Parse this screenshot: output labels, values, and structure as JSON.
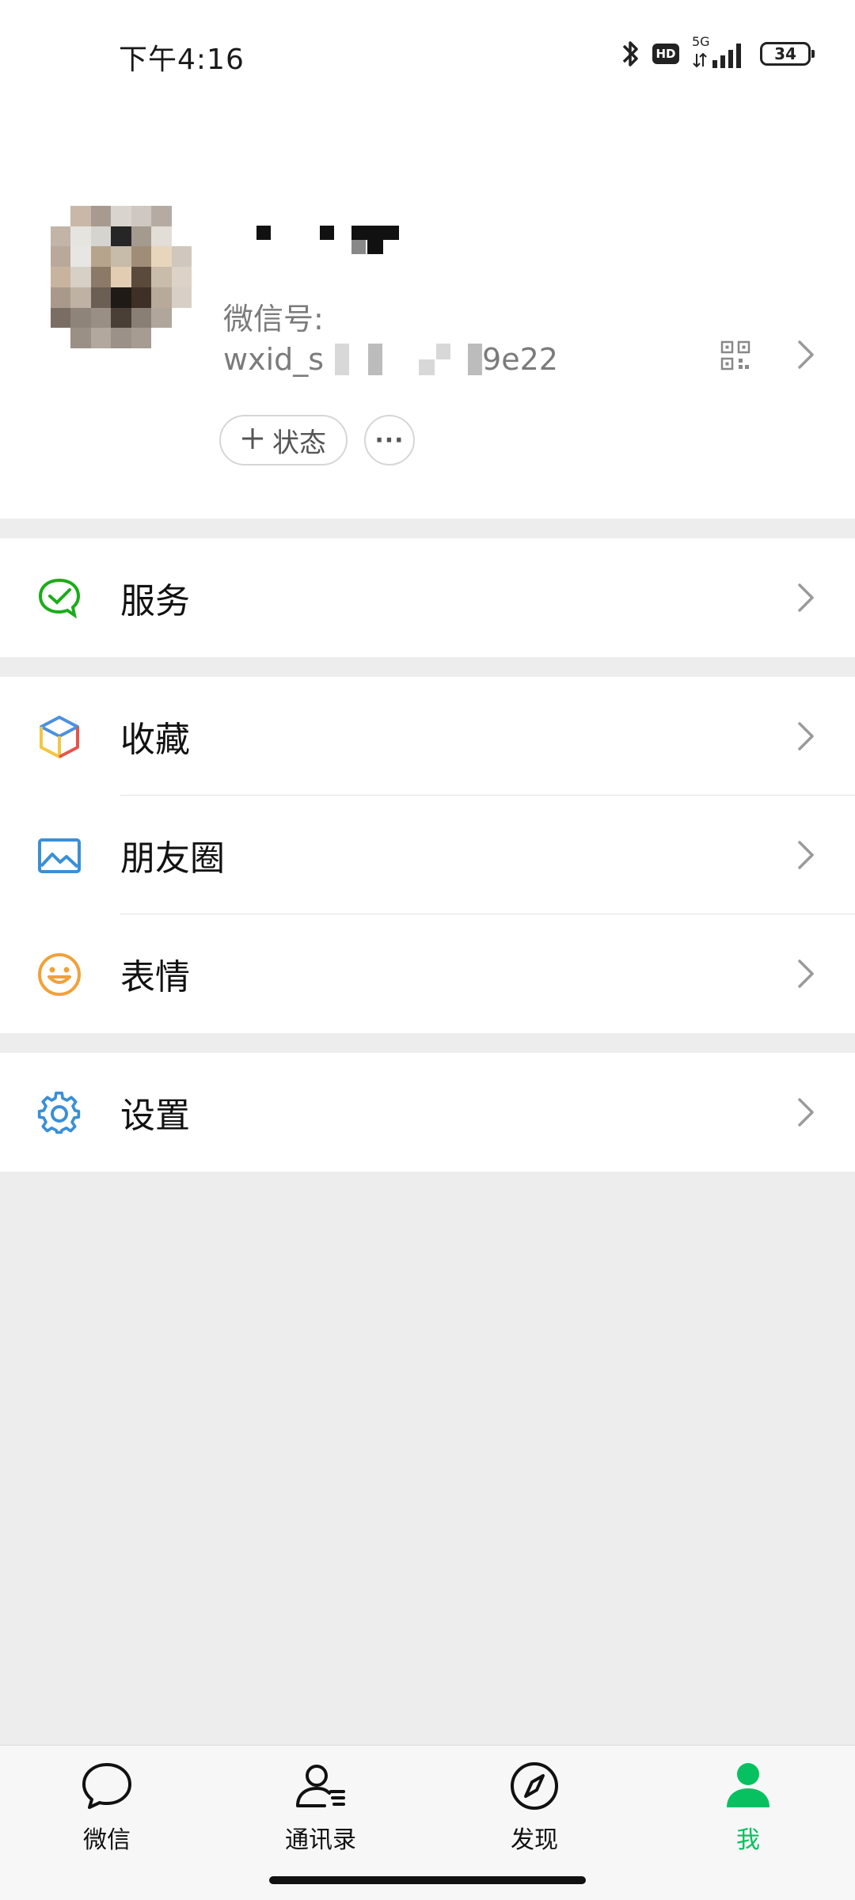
{
  "status_bar": {
    "time": "下午4:16",
    "hd_badge": "HD",
    "network": "5G",
    "battery": "34"
  },
  "profile": {
    "wechat_id_label": "微信号:",
    "wechat_id_prefix": "wxid_s",
    "wechat_id_suffix": "9e22",
    "status_chip_label": "状态",
    "more_chip_label": "···"
  },
  "menu": {
    "services": "服务",
    "favorites": "收藏",
    "moments": "朋友圈",
    "stickers": "表情",
    "settings": "设置"
  },
  "tabbar": {
    "chats": "微信",
    "contacts": "通讯录",
    "discover": "发现",
    "me": "我"
  },
  "colors": {
    "accent_green": "#07c160",
    "background": "#ededed",
    "card": "#ffffff"
  }
}
